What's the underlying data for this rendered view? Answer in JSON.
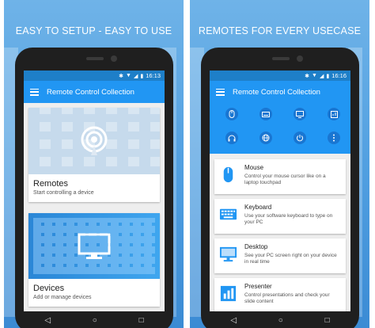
{
  "left_panel": {
    "caption": "EASY TO SETUP - EASY TO USE",
    "status_time": "16:13",
    "app_title": "Remote Control Collection",
    "cards": [
      {
        "title": "Remotes",
        "subtitle": "Start controlling a device",
        "icon": "broadcast-icon"
      },
      {
        "title": "Devices",
        "subtitle": "Add or manage devices",
        "icon": "monitor-icon"
      }
    ]
  },
  "right_panel": {
    "caption": "REMOTES FOR EVERY USECASE",
    "status_time": "16:16",
    "app_title": "Remote Control Collection",
    "quick_icons": [
      "mouse-icon",
      "keyboard-icon",
      "desktop-icon",
      "presenter-icon",
      "headphones-icon",
      "globe-icon",
      "power-icon",
      "more-vert-icon"
    ],
    "items": [
      {
        "title": "Mouse",
        "description": "Control your mouse cursor like on a laptop touchpad",
        "icon": "mouse-icon"
      },
      {
        "title": "Keyboard",
        "description": "Use your software keyboard to type on your PC",
        "icon": "keyboard-icon"
      },
      {
        "title": "Desktop",
        "description": "See your PC screen right on your device in real time",
        "icon": "desktop-icon"
      },
      {
        "title": "Presenter",
        "description": "Control presentations and check your slide content",
        "icon": "presenter-icon"
      }
    ]
  },
  "colors": {
    "primary": "#2196f3",
    "primary_dark": "#1976d2",
    "status_bar": "#1e7fc8"
  }
}
